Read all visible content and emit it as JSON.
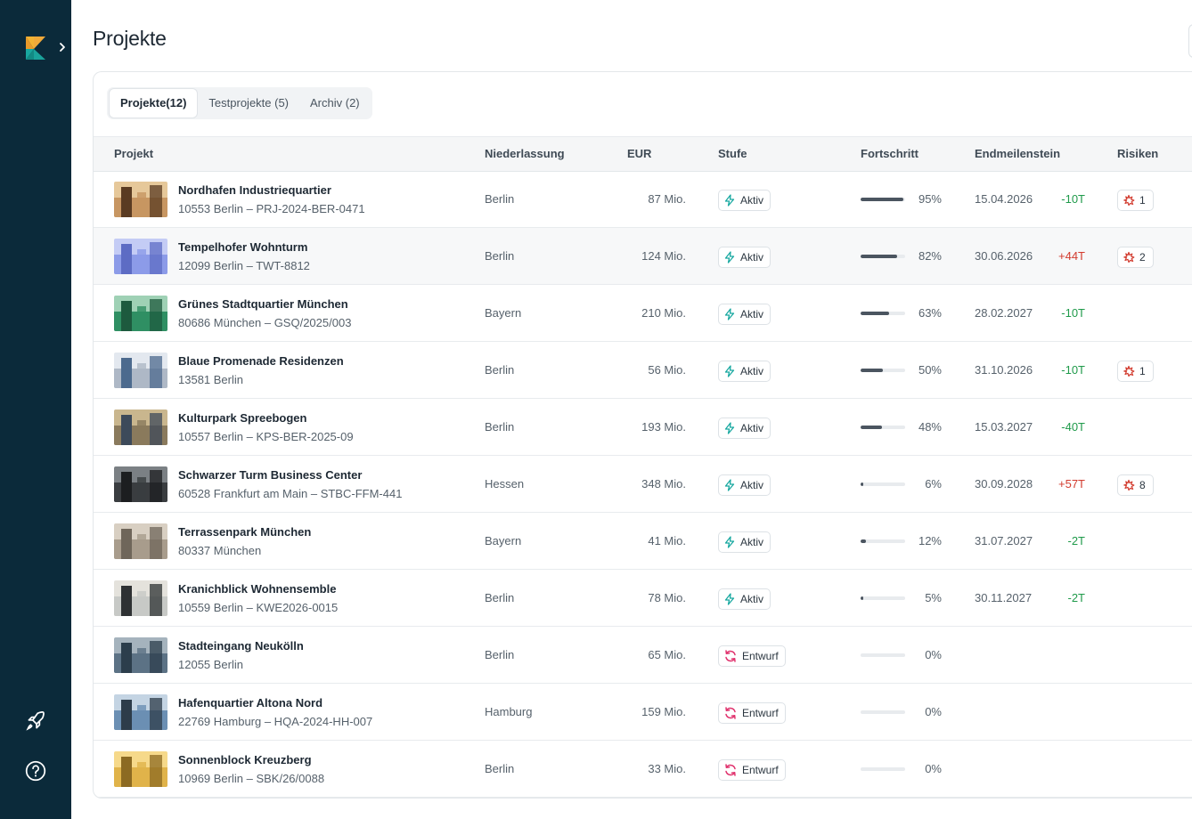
{
  "page_title": "Projekte",
  "tabs": [
    {
      "label": "Projekte(12)",
      "active": true
    },
    {
      "label": "Testprojekte (5)",
      "active": false
    },
    {
      "label": "Archiv (2)",
      "active": false
    }
  ],
  "columns": {
    "projekt": "Projekt",
    "niederlassung": "Niederlassung",
    "eur": "EUR",
    "stufe": "Stufe",
    "fortschritt": "Fortschritt",
    "endmeilenstein": "Endmeilenstein",
    "risiken": "Risiken"
  },
  "colors": {
    "sidebar": "#0b2a3a",
    "aktiv_icon": "#17a8a0",
    "entwurf_icon": "#e0336e",
    "delta_negative": "#1f9a4a",
    "delta_positive": "#d23b2e",
    "risk_icon": "#d23b2e"
  },
  "icons": {
    "logo": "k-logo-icon",
    "expand": "chevron-right-icon",
    "rocket": "rocket-icon",
    "help": "help-circle-icon",
    "aktiv": "lightning-icon",
    "entwurf": "sync-icon",
    "risk": "risk-burst-icon"
  },
  "projects": [
    {
      "name": "Nordhafen Industriequartier",
      "sub": "10553 Berlin – PRJ-2024-BER-0471",
      "nl": "Berlin",
      "eur": "87 Mio.",
      "stage": "Aktiv",
      "progress": 95,
      "progress_label": "95%",
      "date": "15.04.2026",
      "delta": "-10T",
      "risks": "1"
    },
    {
      "name": "Tempelhofer Wohnturm",
      "sub": "12099 Berlin – TWT-8812",
      "nl": "Berlin",
      "eur": "124 Mio.",
      "stage": "Aktiv",
      "progress": 82,
      "progress_label": "82%",
      "date": "30.06.2026",
      "delta": "+44T",
      "risks": "2"
    },
    {
      "name": "Grünes Stadtquartier München",
      "sub": "80686 München – GSQ/2025/003",
      "nl": "Bayern",
      "eur": "210 Mio.",
      "stage": "Aktiv",
      "progress": 63,
      "progress_label": "63%",
      "date": "28.02.2027",
      "delta": "-10T",
      "risks": ""
    },
    {
      "name": "Blaue Promenade Residenzen",
      "sub": "13581 Berlin",
      "nl": "Berlin",
      "eur": "56 Mio.",
      "stage": "Aktiv",
      "progress": 50,
      "progress_label": "50%",
      "date": "31.10.2026",
      "delta": "-10T",
      "risks": "1"
    },
    {
      "name": "Kulturpark Spreebogen",
      "sub": "10557 Berlin – KPS-BER-2025-09",
      "nl": "Berlin",
      "eur": "193 Mio.",
      "stage": "Aktiv",
      "progress": 48,
      "progress_label": "48%",
      "date": "15.03.2027",
      "delta": "-40T",
      "risks": ""
    },
    {
      "name": "Schwarzer Turm Business Center",
      "sub": "60528 Frankfurt am Main – STBC-FFM-441",
      "nl": "Hessen",
      "eur": "348 Mio.",
      "stage": "Aktiv",
      "progress": 6,
      "progress_label": "6%",
      "date": "30.09.2028",
      "delta": "+57T",
      "risks": "8"
    },
    {
      "name": "Terrassenpark München",
      "sub": "80337 München",
      "nl": "Bayern",
      "eur": "41 Mio.",
      "stage": "Aktiv",
      "progress": 12,
      "progress_label": "12%",
      "date": "31.07.2027",
      "delta": "-2T",
      "risks": ""
    },
    {
      "name": "Kranichblick Wohnensemble",
      "sub": "10559 Berlin – KWE2026-0015",
      "nl": "Berlin",
      "eur": "78 Mio.",
      "stage": "Aktiv",
      "progress": 5,
      "progress_label": "5%",
      "date": "30.11.2027",
      "delta": "-2T",
      "risks": ""
    },
    {
      "name": "Stadteingang Neukölln",
      "sub": "12055 Berlin",
      "nl": "Berlin",
      "eur": "65 Mio.",
      "stage": "Entwurf",
      "progress": 0,
      "progress_label": "0%",
      "date": "",
      "delta": "",
      "risks": ""
    },
    {
      "name": "Hafenquartier Altona Nord",
      "sub": "22769 Hamburg – HQA-2024-HH-007",
      "nl": "Hamburg",
      "eur": "159 Mio.",
      "stage": "Entwurf",
      "progress": 0,
      "progress_label": "0%",
      "date": "",
      "delta": "",
      "risks": ""
    },
    {
      "name": "Sonnenblock Kreuzberg",
      "sub": "10969 Berlin – SBK/26/0088",
      "nl": "Berlin",
      "eur": "33 Mio.",
      "stage": "Entwurf",
      "progress": 0,
      "progress_label": "0%",
      "date": "",
      "delta": "",
      "risks": ""
    }
  ]
}
